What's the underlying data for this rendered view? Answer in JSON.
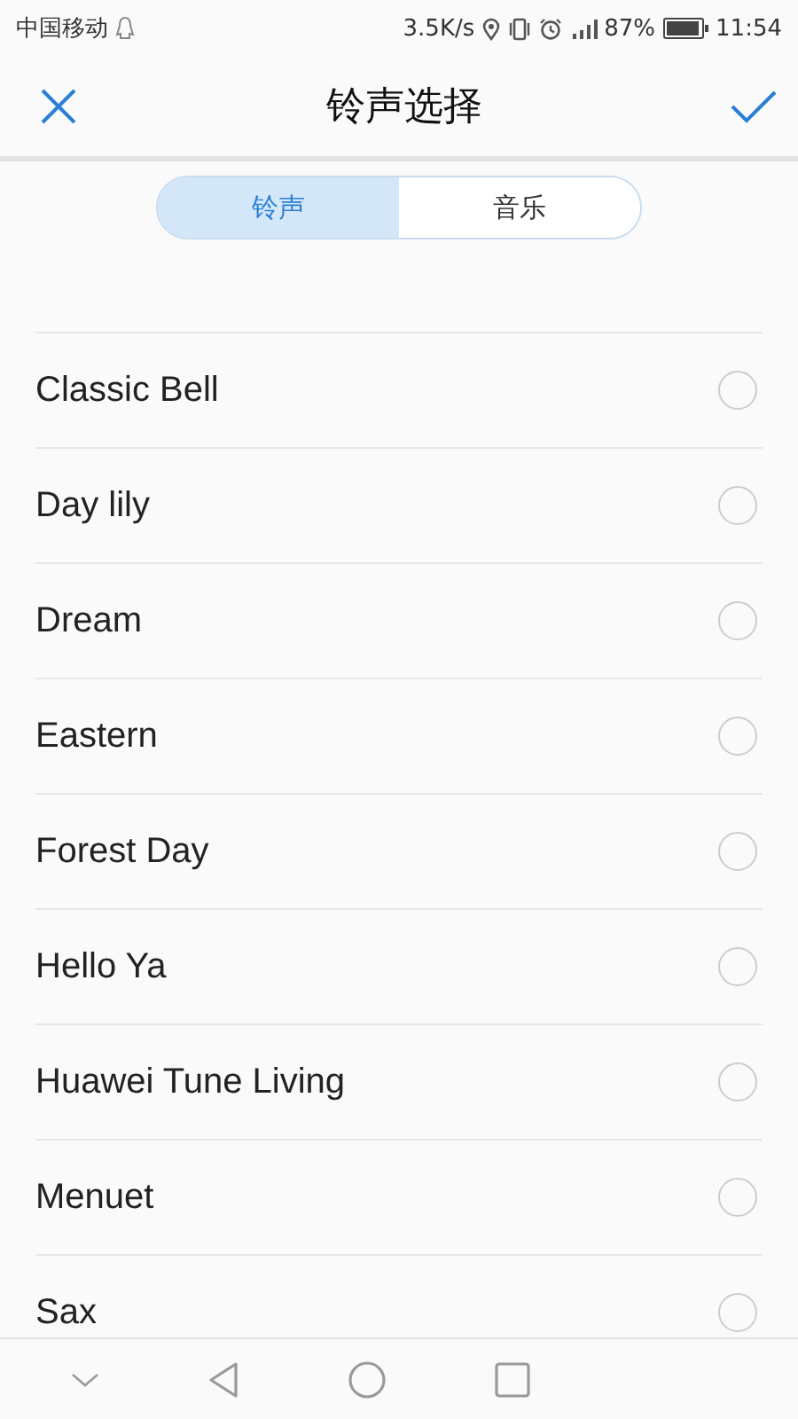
{
  "status_bar": {
    "carrier": "中国移动",
    "speed": "3.5K/s",
    "battery": "87%",
    "time": "11:54"
  },
  "header": {
    "title": "铃声选择"
  },
  "tabs": [
    {
      "label": "铃声",
      "selected": true
    },
    {
      "label": "音乐",
      "selected": false
    }
  ],
  "items": [
    {
      "name": "Classic Bell",
      "selected": false
    },
    {
      "name": "Day lily",
      "selected": false
    },
    {
      "name": "Dream",
      "selected": false
    },
    {
      "name": "Eastern",
      "selected": false
    },
    {
      "name": "Forest Day",
      "selected": false
    },
    {
      "name": "Hello Ya",
      "selected": false
    },
    {
      "name": "Huawei Tune Living",
      "selected": false
    },
    {
      "name": "Menuet",
      "selected": false
    },
    {
      "name": "Sax",
      "selected": false
    }
  ]
}
